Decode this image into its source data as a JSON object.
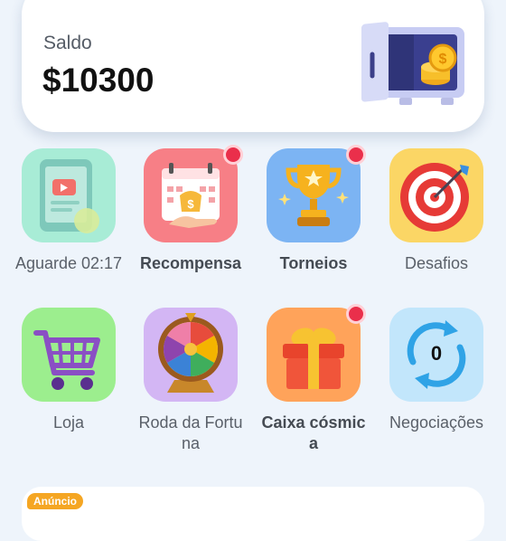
{
  "balance": {
    "label": "Saldo",
    "value": "$10300"
  },
  "tiles": [
    {
      "label": "Aguarde 02:17",
      "icon": "video-tablet-icon",
      "bold": false,
      "badge": false
    },
    {
      "label": "Recompensa",
      "icon": "calendar-reward-icon",
      "bold": true,
      "badge": true
    },
    {
      "label": "Torneios",
      "icon": "trophy-icon",
      "bold": true,
      "badge": true
    },
    {
      "label": "Desafios",
      "icon": "target-icon",
      "bold": false,
      "badge": false
    },
    {
      "label": "Loja",
      "icon": "shopping-cart-icon",
      "bold": false,
      "badge": false
    },
    {
      "label": "Roda da Fortuna",
      "icon": "fortune-wheel-icon",
      "bold": false,
      "badge": false
    },
    {
      "label": "Caixa cósmica",
      "icon": "gift-box-icon",
      "bold": true,
      "badge": true
    },
    {
      "label": "Negociações",
      "icon": "trade-cycle-icon",
      "bold": false,
      "badge": false,
      "count": "0"
    }
  ],
  "ad": {
    "badge": "Anúncio"
  },
  "colors": {
    "background": "#eef4fb",
    "notification_dot": "#ea2f4b",
    "ad_badge": "#f5a623"
  }
}
